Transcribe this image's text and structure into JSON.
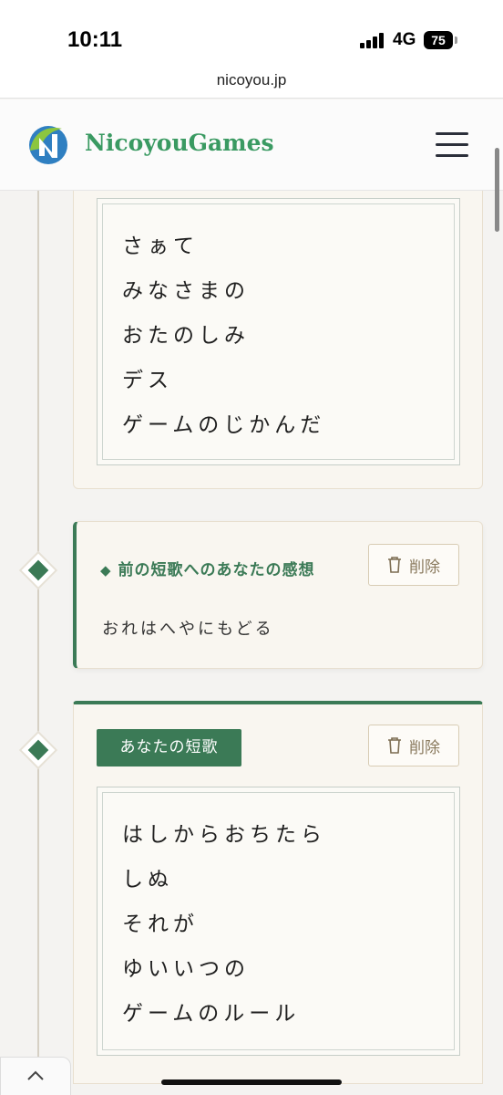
{
  "status_bar": {
    "time": "10:11",
    "network": "4G",
    "battery": "75"
  },
  "browser": {
    "url": "nicoyou.jp"
  },
  "header": {
    "brand": "NicoyouGames",
    "logo_icon": "nicoyou-logo-icon",
    "menu_icon": "hamburger-menu-icon"
  },
  "poem_1": {
    "lines": [
      "さぁて",
      "みなさまの",
      "おたのしみ",
      "デス",
      "ゲームのじかんだ"
    ]
  },
  "impression": {
    "title": "前の短歌へのあなたの感想",
    "delete_label": "削除",
    "text": "おれはへやにもどる"
  },
  "your_tanka": {
    "badge": "あなたの短歌",
    "delete_label": "削除",
    "lines": [
      "はしからおちたら",
      "しぬ",
      "それが",
      "ゆいいつの",
      "ゲームのルール"
    ]
  },
  "colors": {
    "accent_green": "#3b7a56",
    "brand_green": "#3a9a62",
    "card_bg": "#f9f6f0"
  }
}
